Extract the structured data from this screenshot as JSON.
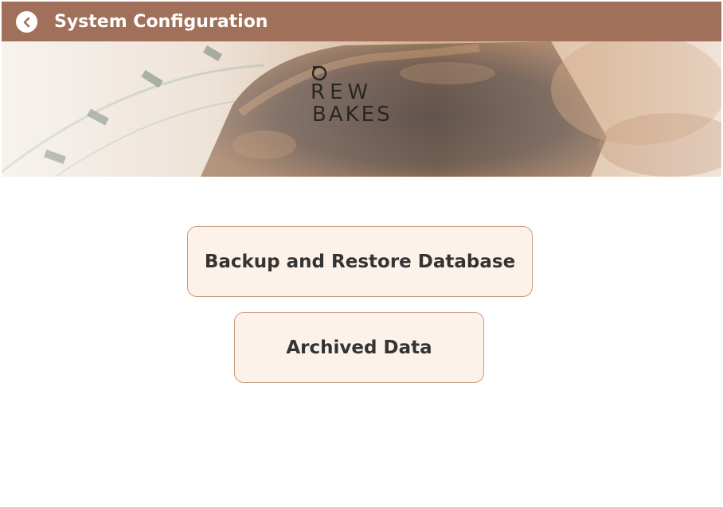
{
  "header": {
    "title": "System Configuration",
    "back_icon": "chevron-left-icon",
    "background_color": "#a0705a"
  },
  "banner": {
    "logo_line1": "REW",
    "logo_line2": "BAKES"
  },
  "main": {
    "buttons": [
      {
        "label": "Backup and Restore Database"
      },
      {
        "label": "Archived Data"
      }
    ],
    "button_background": "#fdf2ea",
    "button_border": "#c89c80"
  }
}
